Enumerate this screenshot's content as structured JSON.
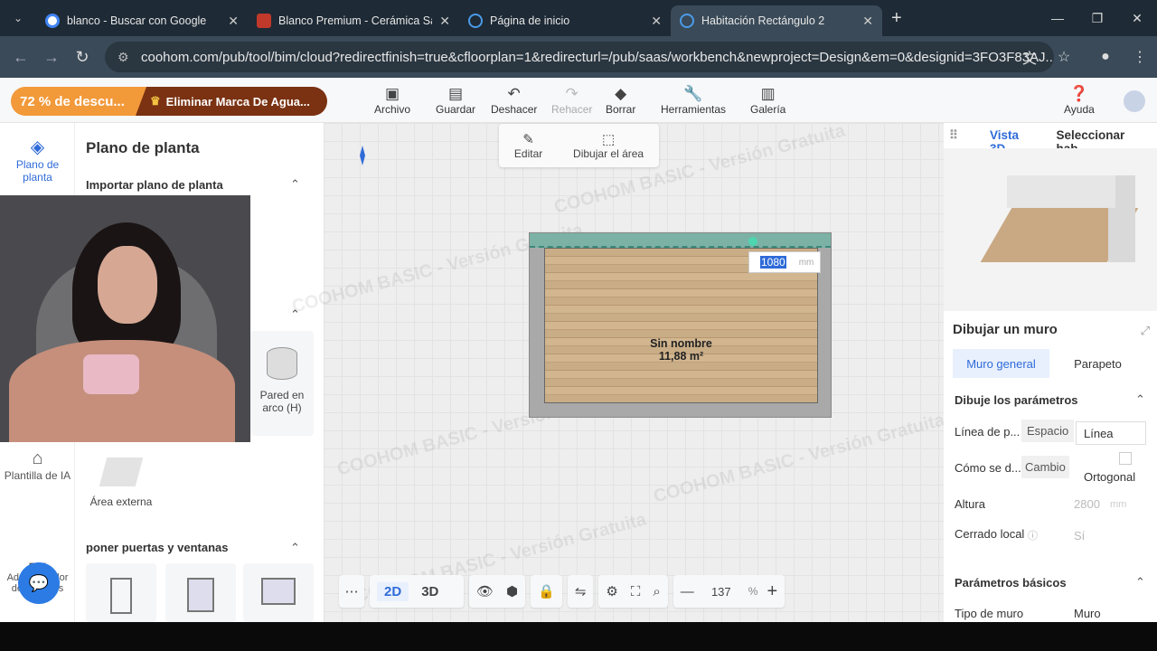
{
  "browser": {
    "tabs": [
      {
        "title": "blanco - Buscar con Google",
        "favicon": "google-icon",
        "active": false
      },
      {
        "title": "Blanco Premium - Cerámica San Lo",
        "favicon": "site-icon",
        "active": false
      },
      {
        "title": "Página de inicio",
        "favicon": "coohom-icon",
        "active": false
      },
      {
        "title": "Habitación Rectángulo 2",
        "favicon": "coohom-icon",
        "active": true
      }
    ],
    "url": "coohom.com/pub/tool/bim/cloud?redirectfinish=true&cfloorplan=1&redirecturl=/pub/saas/workbench&newproject=Design&em=0&designid=3FO3F83AJ..."
  },
  "promo": {
    "discount": "72 % de descu...",
    "remove_watermark": "Eliminar Marca De Agua..."
  },
  "toolbar": {
    "archivo": "Archivo",
    "guardar": "Guardar",
    "deshacer": "Deshacer",
    "rehacer": "Rehacer",
    "borrar": "Borrar",
    "herramientas": "Herramientas",
    "galeria": "Galería",
    "ayuda": "Ayuda"
  },
  "rail": {
    "floorplan": "Plano de planta",
    "ai_template": "Plantilla de IA",
    "admin": "Administrador de recursos"
  },
  "left_panel": {
    "title": "Plano de planta",
    "import_section": "Importar plano de planta",
    "arc_wall": "Pared en arco (H)",
    "external_area": "Área externa",
    "doors_section": "poner puertas y ventanas"
  },
  "edit_toolbar": {
    "edit": "Editar",
    "draw_area": "Dibujar el área"
  },
  "canvas": {
    "watermark": "COOHOM BASIC - Versión Gratuita",
    "room_name": "Sin nombre",
    "room_area": "11,88 m²",
    "dimension_value": "1080",
    "dimension_unit": "mm"
  },
  "bottom_bar": {
    "mode2d": "2D",
    "mode3d": "3D",
    "zoom": "137",
    "zoom_unit": "%"
  },
  "right_panel": {
    "tab_3d": "Vista 3D",
    "tab_select": "Seleccionar hab...",
    "title": "Dibujar un muro",
    "seg_general": "Muro general",
    "seg_parapet": "Parapeto",
    "params_title": "Dibuje los parámetros",
    "line_label": "Línea de p...",
    "line_option1": "Espacio",
    "line_option2": "Línea",
    "how_label": "Cómo se d...",
    "how_option1": "Cambio",
    "how_option2": "Ortogonal",
    "height_label": "Altura",
    "height_value": "2800",
    "height_unit": "mm",
    "closed_label": "Cerrado local",
    "closed_value": "Sí",
    "basic_title": "Parámetros básicos",
    "wall_type_label": "Tipo de muro",
    "wall_type_value": "Muro"
  },
  "colors": {
    "accent": "#2f6bd8",
    "promo_orange": "#f2993a",
    "promo_brown": "#7a3212"
  }
}
